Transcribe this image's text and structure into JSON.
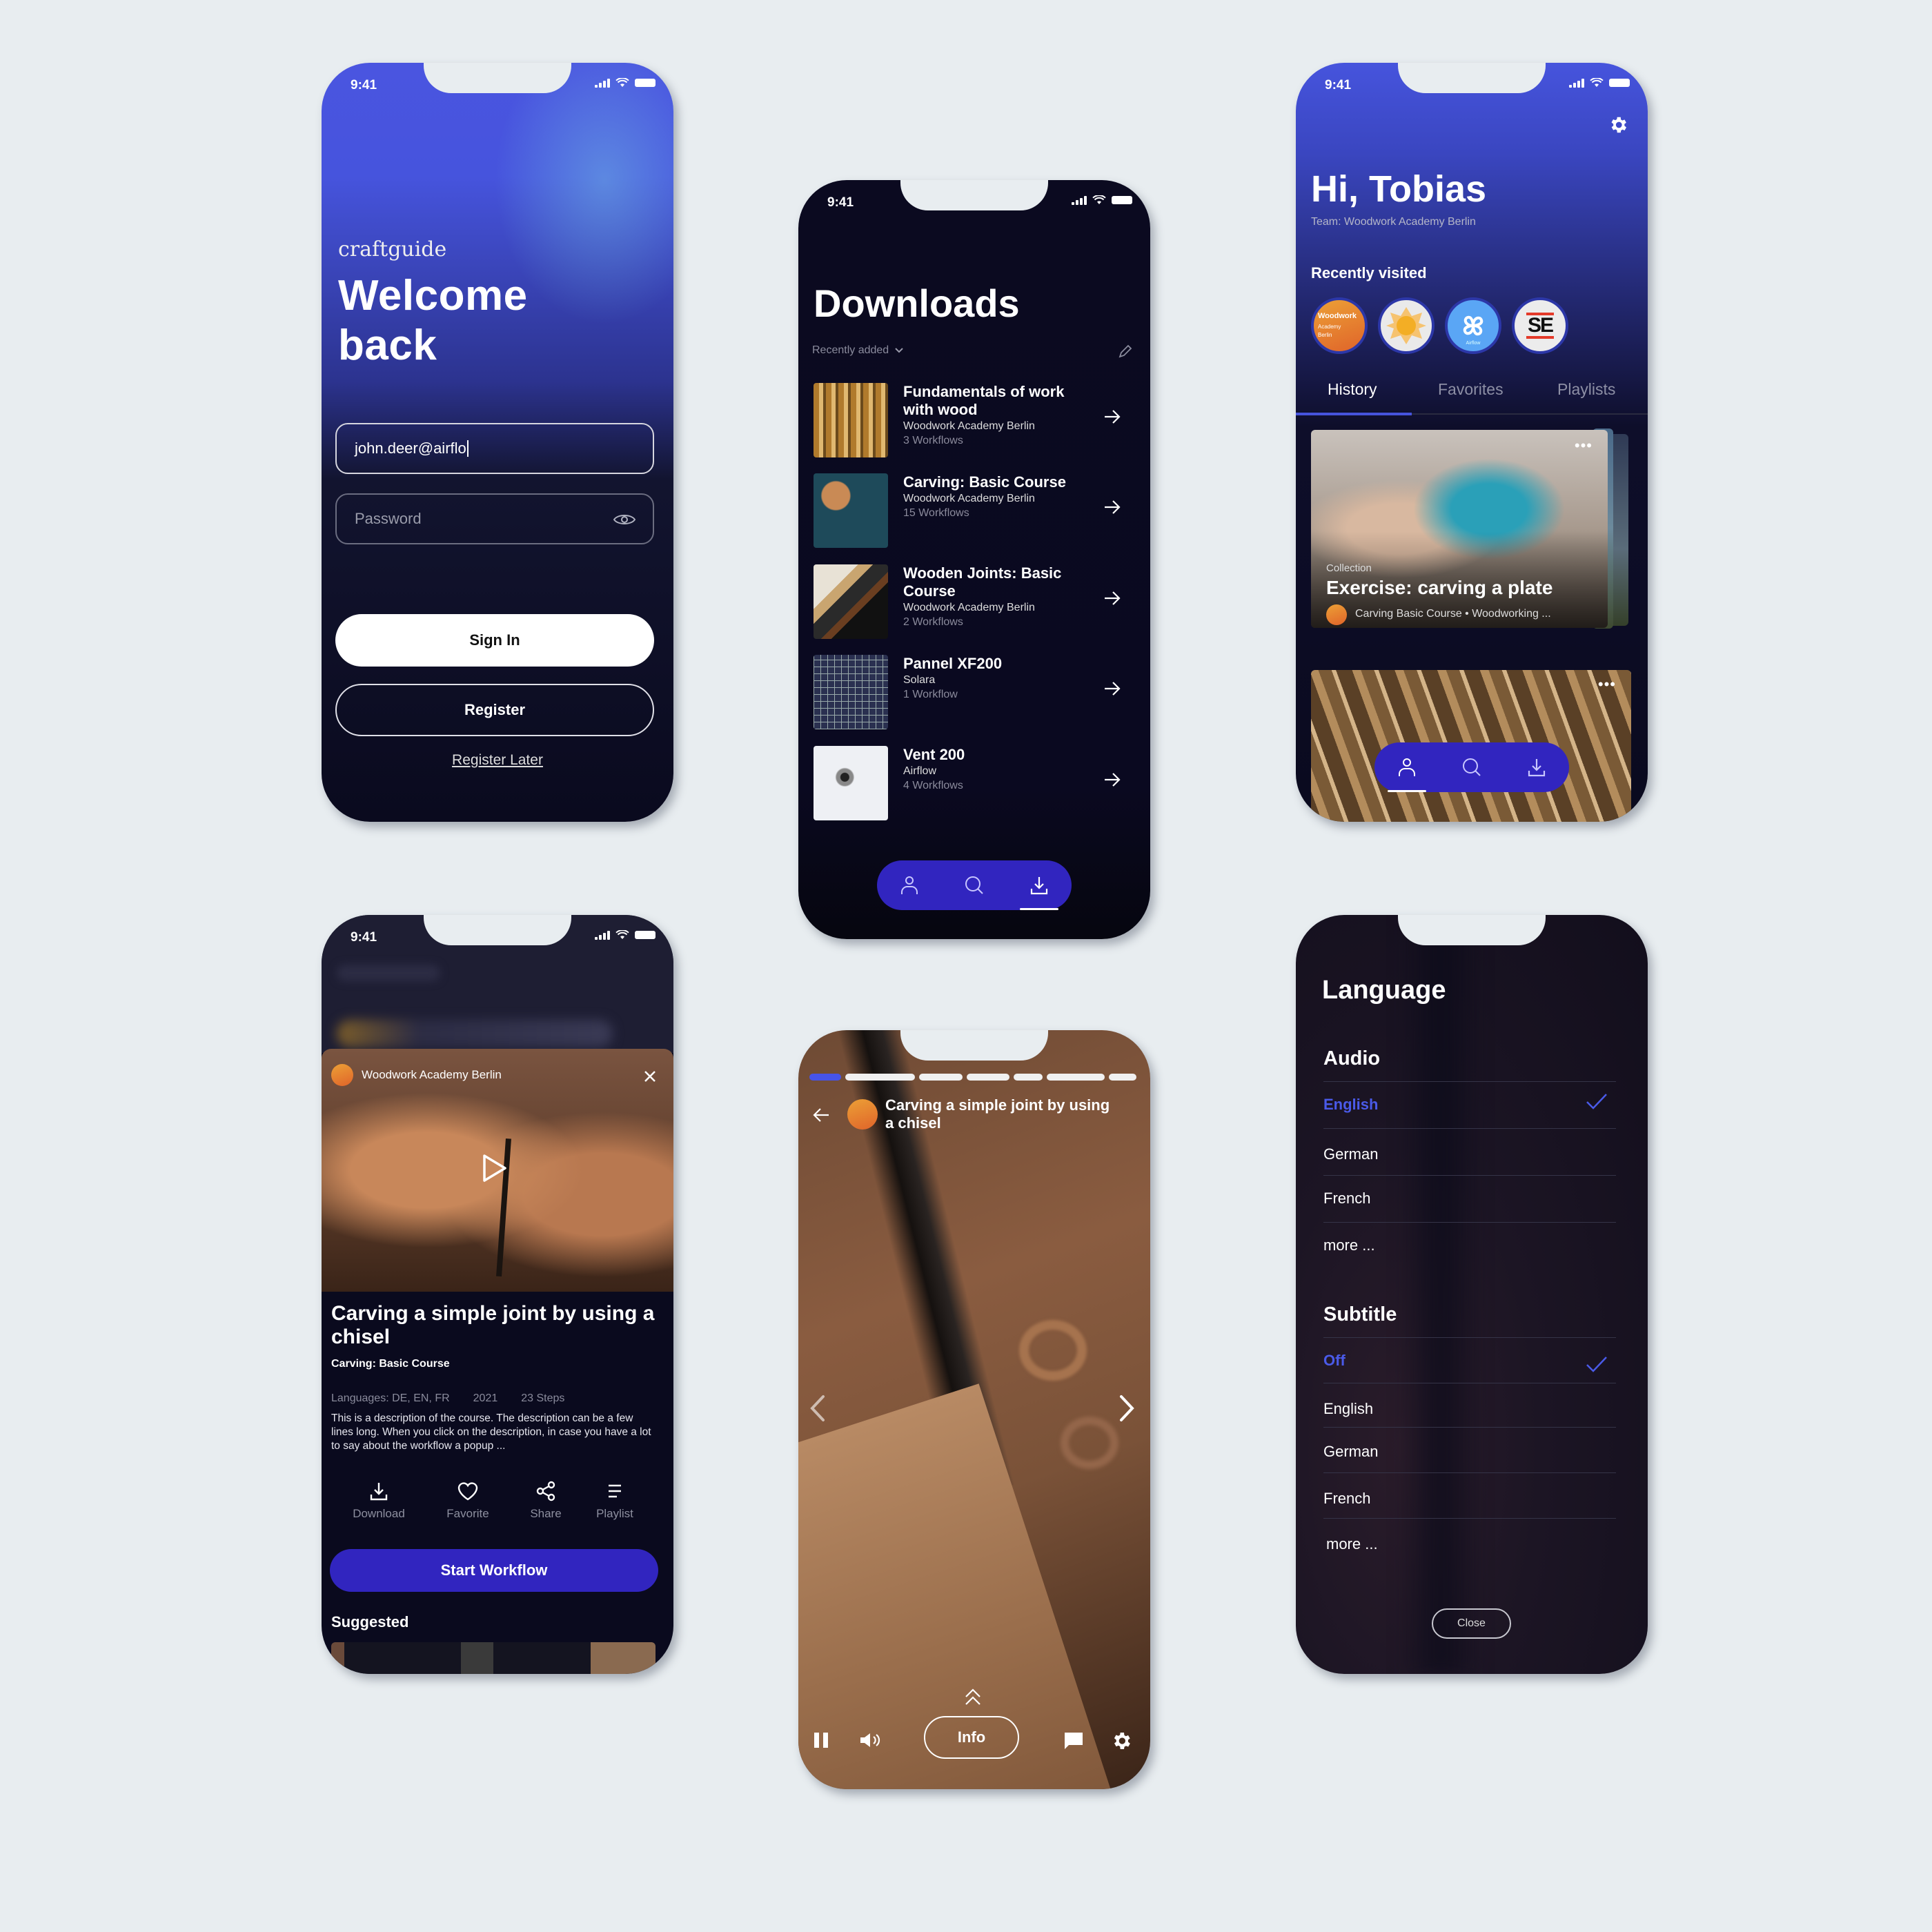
{
  "status_bar": {
    "time": "9:41"
  },
  "colors": {
    "accent": "#3125bf",
    "accent_light": "#4a5ae8",
    "background": "#e8edf0",
    "dark": "#0a0a1e"
  },
  "login": {
    "brand": "craftguide",
    "title_line1": "Welcome",
    "title_line2": "back",
    "email_value": "john.deer@airflo",
    "password_placeholder": "Password",
    "sign_in_label": "Sign In",
    "register_label": "Register",
    "register_later_label": "Register Later"
  },
  "downloads": {
    "title": "Downloads",
    "sort_label": "Recently added",
    "items": [
      {
        "title": "Fundamentals of work with wood",
        "org": "Woodwork Academy Berlin",
        "count": "3 Workflows"
      },
      {
        "title": "Carving: Basic Course",
        "org": "Woodwork Academy Berlin",
        "count": "15 Workflows"
      },
      {
        "title": "Wooden Joints: Basic Course",
        "org": "Woodwork Academy Berlin",
        "count": "2 Workflows"
      },
      {
        "title": "Pannel XF200",
        "org": "Solara",
        "count": "1 Workflow"
      },
      {
        "title": "Vent 200",
        "org": "Airflow",
        "count": "4 Workflows"
      }
    ],
    "nav": [
      "profile",
      "search",
      "downloads"
    ],
    "nav_active": "downloads"
  },
  "home": {
    "greeting": "Hi, Tobias",
    "team": "Team: Woodwork Academy Berlin",
    "recent_label": "Recently visited",
    "recent": [
      {
        "name": "Woodwork Academy Berlin",
        "line1": "Woodwork",
        "line2": "Academy",
        "line3": "Berlin"
      },
      {
        "name": "Solara"
      },
      {
        "name": "Airflow",
        "label": "Airflow"
      },
      {
        "name": "SE",
        "label": "SE"
      }
    ],
    "tabs": [
      "History",
      "Favorites",
      "Playlists"
    ],
    "active_tab": "History",
    "card": {
      "eyebrow": "Collection",
      "title": "Exercise: carving a plate",
      "meta": "Carving Basic Course • Woodworking ..."
    },
    "nav_active": "profile"
  },
  "detail": {
    "org": "Woodwork Academy Berlin",
    "title": "Carving a simple joint by using a chisel",
    "course": "Carving: Basic Course",
    "languages": "Languages: DE, EN, FR",
    "year": "2021",
    "steps": "23 Steps",
    "description": "This is a description of the course. The description can be a few lines long. When you click on the description, in case you have a lot to say about the workflow a popup ...",
    "actions": [
      "Download",
      "Favorite",
      "Share",
      "Playlist"
    ],
    "start_label": "Start Workflow",
    "suggested_label": "Suggested"
  },
  "player": {
    "title": "Carving a simple joint by using a chisel",
    "steps_total": 7,
    "current_step": 1,
    "info_label": "Info"
  },
  "language": {
    "title": "Language",
    "audio_label": "Audio",
    "audio_options": [
      "English",
      "German",
      "French",
      "more ..."
    ],
    "audio_selected": "English",
    "subtitle_label": "Subtitle",
    "subtitle_options": [
      "Off",
      "English",
      "German",
      "French",
      "more ..."
    ],
    "subtitle_selected": "Off",
    "close_label": "Close"
  }
}
